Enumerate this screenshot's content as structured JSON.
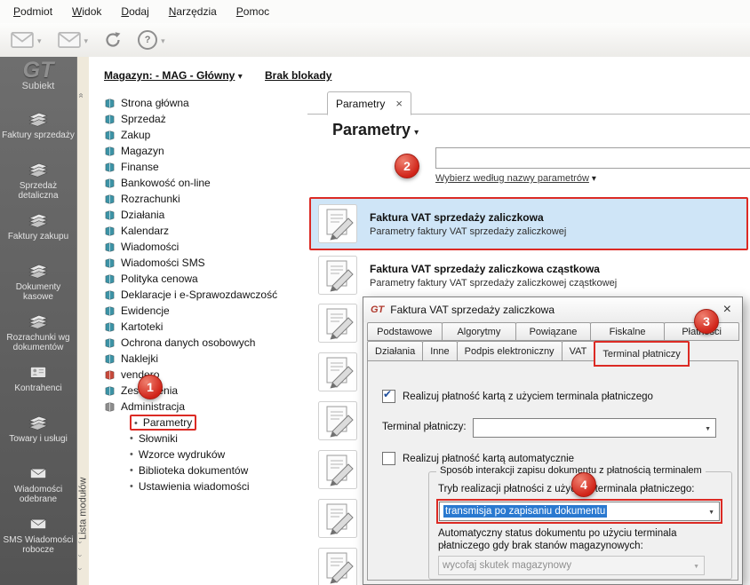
{
  "brand": {
    "gt": "GT",
    "name": "Subiekt"
  },
  "menubar": {
    "items": [
      "Podmiot",
      "Widok",
      "Dodaj",
      "Narzędzia",
      "Pomoc"
    ]
  },
  "toolbar": {
    "buttons": [
      {
        "icon": "send-mail-icon"
      },
      {
        "icon": "mail-icon"
      },
      {
        "icon": "refresh-icon"
      },
      {
        "icon": "help-icon"
      }
    ]
  },
  "topbar": {
    "warehouse": "Magazyn: - MAG - Główny",
    "lock_status": "Brak blokady"
  },
  "sidebar": {
    "strip_label": "Lista modułów",
    "modules": [
      {
        "label": "Faktury sprzedaży",
        "icon": "sales-invoices-icon"
      },
      {
        "label": "Sprzedaż detaliczna",
        "icon": "retail-sales-icon"
      },
      {
        "label": "Faktury zakupu",
        "icon": "purchase-invoices-icon"
      },
      {
        "label": "Dokumenty kasowe",
        "icon": "cash-documents-icon"
      },
      {
        "label": "Rozrachunki wg dokumentów",
        "icon": "settlements-icon"
      },
      {
        "label": "Kontrahenci",
        "icon": "contractors-icon"
      },
      {
        "label": "Towary i usługi",
        "icon": "goods-services-icon"
      },
      {
        "label": "Wiadomości odebrane",
        "icon": "inbox-icon"
      },
      {
        "label": "SMS Wiadomości robocze",
        "icon": "sms-drafts-icon"
      }
    ]
  },
  "tree": {
    "items": [
      "Strona główna",
      "Sprzedaż",
      "Zakup",
      "Magazyn",
      "Finanse",
      "Bankowość on-line",
      "Rozrachunki",
      "Działania",
      "Kalendarz",
      "Wiadomości",
      "Wiadomości SMS",
      "Polityka cenowa",
      "Deklaracje i e-Sprawozdawczość",
      "Ewidencje",
      "Kartoteki",
      "Ochrona danych osobowych",
      "Naklejki",
      "vendero",
      "Zestawienia",
      "Administracja"
    ],
    "admin_children": [
      "Parametry",
      "Słowniki",
      "Wzorce wydruków",
      "Biblioteka dokumentów",
      "Ustawienia wiadomości"
    ]
  },
  "main": {
    "tab_label": "Parametry",
    "tab_close": "×",
    "title": "Parametry",
    "search_value": "",
    "filter_link": "Wybierz według nazwy parametrów",
    "items": [
      {
        "title": "Faktura VAT sprzedaży zaliczkowa",
        "subtitle": "Parametry faktury VAT sprzedaży zaliczkowej"
      },
      {
        "title": "Faktura VAT sprzedaży zaliczkowa cząstkowa",
        "subtitle": "Parametry faktury VAT sprzedaży zaliczkowej cząstkowej"
      }
    ]
  },
  "dialog": {
    "title": "Faktura VAT sprzedaży zaliczkowa",
    "close": "×",
    "tabs_row1": [
      "Podstawowe",
      "Algorytmy",
      "Powiązane",
      "Fiskalne",
      "Płatności"
    ],
    "tabs_row2": [
      "Działania",
      "Inne",
      "Podpis elektroniczny",
      "VAT",
      "Terminal płatniczy"
    ],
    "checkbox_card_payment": "Realizuj płatność kartą z użyciem terminala płatniczego",
    "terminal_label": "Terminal płatniczy:",
    "checkbox_auto": "Realizuj płatność kartą automatycznie",
    "group_title": "Sposób interakcji zapisu dokumentu z płatnością terminalem",
    "mode_label": "Tryb realizacji płatności z użyciem terminala płatniczego:",
    "mode_value": "transmisja po zapisaniu dokumentu",
    "auto_status_label": "Automatyczny status dokumentu po użyciu terminala płatniczego gdy brak stanów magazynowych:",
    "auto_status_value": "wycofaj skutek magazynowy"
  },
  "badges": {
    "step1": "1",
    "step2": "2",
    "step3": "3",
    "step4": "4"
  },
  "colors": {
    "annotation_red": "#dc2a24",
    "selection_blue": "#cfe5f7",
    "sidebar_gray": "#5e5e5e"
  }
}
